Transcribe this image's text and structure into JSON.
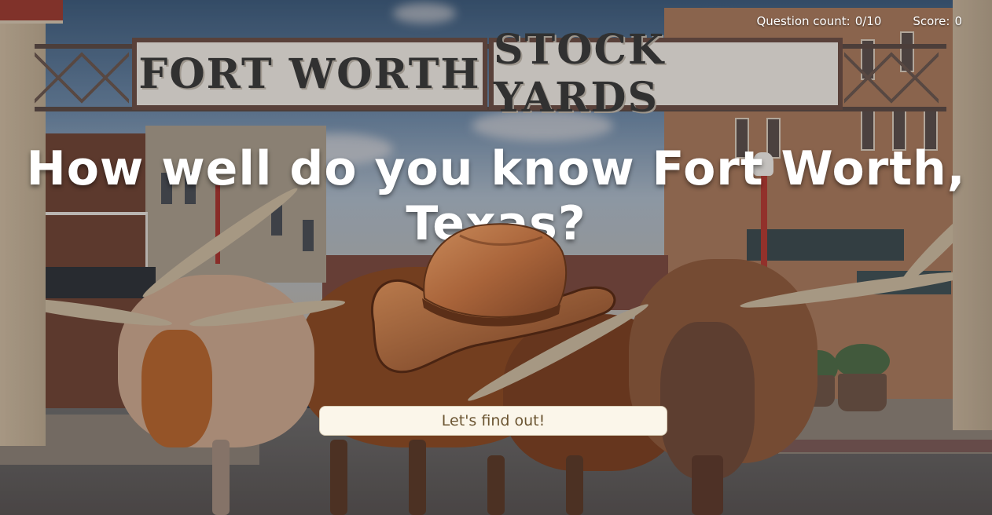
{
  "hud": {
    "question_label": "Question count:",
    "question_value": "0/10",
    "score_label": "Score:",
    "score_value": "0"
  },
  "sign": {
    "left_panel": "FORT WORTH",
    "right_panel": "STOCK YARDS"
  },
  "hero": {
    "title": "How well do you know Fort Worth, Texas?",
    "start_button": "Let's find out!"
  },
  "colors": {
    "button_bg": "#fbf6ea",
    "button_text": "#6b5532",
    "title_text": "#ffffff",
    "hat_brown": "#a9643a"
  },
  "icons": {
    "hat": "cowboy-hat-icon"
  }
}
